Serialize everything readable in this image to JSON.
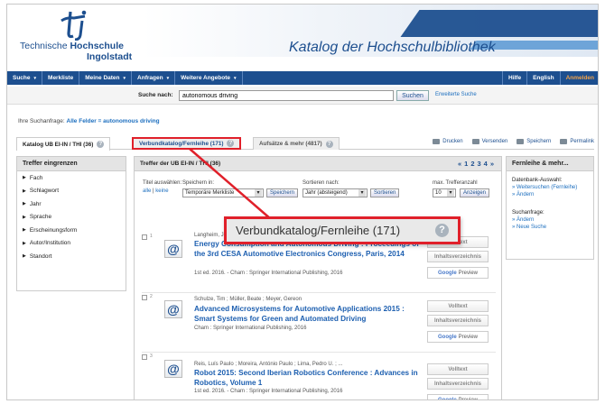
{
  "header": {
    "logo_line1_a": "Technische ",
    "logo_line1_b": "Hochschule",
    "logo_line2": "Ingolstadt",
    "catalog_title": "Katalog der Hochschulbibliothek"
  },
  "nav": {
    "items": [
      {
        "label": "Suche",
        "dd": "▾"
      },
      {
        "label": "Merkliste",
        "dd": ""
      },
      {
        "label": "Meine Daten",
        "dd": "▾"
      },
      {
        "label": "Anfragen",
        "dd": "▾"
      },
      {
        "label": "Weitere Angebote",
        "dd": "▾"
      }
    ],
    "right": [
      "Hilfe",
      "English",
      "Anmelden"
    ]
  },
  "search": {
    "label": "Suche nach:",
    "value": "autonomous driving",
    "button": "Suchen",
    "advanced": "Erweiterte Suche"
  },
  "query": {
    "prefix": "Ihre Suchanfrage:",
    "value": "Alle Felder = autonomous driving"
  },
  "tabs": [
    {
      "label": "Katalog UB EI-IN / THI (36)"
    },
    {
      "label": "Verbundkatalog/Fernleihe (171)"
    },
    {
      "label": "Aufsätze & mehr (4817)"
    }
  ],
  "tools": [
    "Drucken",
    "Versenden",
    "Speichern",
    "Permalink"
  ],
  "facets": {
    "heading": "Treffer eingrenzen",
    "items": [
      "Fach",
      "Schlagwort",
      "Jahr",
      "Sprache",
      "Erscheinungsform",
      "Autor/Institution",
      "Standort"
    ]
  },
  "results": {
    "heading": "Treffer der UB EI-IN / THI (36)",
    "pager": [
      "«",
      "1",
      "2",
      "3",
      "4",
      "»"
    ],
    "controls": {
      "select_label": "Titel auswählen:",
      "select_all": "alle",
      "select_none": "keine",
      "save_label": "Speichern in:",
      "save_value": "Temporäre Merkliste",
      "save_btn": "Speichern",
      "sort_label": "Sortieren nach:",
      "sort_value": "Jahr (absteigend)",
      "sort_btn": "Sortieren",
      "max_label": "max. Trefferanzahl",
      "max_value": "10",
      "show_btn": "Anzeigen"
    },
    "items": [
      {
        "num": "1",
        "authors": "Langheim, Jochen",
        "title": "Energy Consumption and Autonomous Driving : Proceedings of the 3rd CESA Automotive Electronics Congress, Paris, 2014",
        "meta": "1st ed. 2016. - Cham : Springer International Publishing, 2016"
      },
      {
        "num": "2",
        "authors": "Schulze, Tim ; Müller, Beate ; Meyer, Gereon",
        "title": "Advanced Microsystems for Automotive Applications 2015 : Smart Systems for Green and Automated Driving",
        "meta": "Cham : Springer International Publishing, 2016"
      },
      {
        "num": "3",
        "authors": "Reis, Luís Paulo ; Moreira, António Paulo ; Lima, Pedro U. ; ...",
        "title": "Robot 2015: Second Iberian Robotics Conference : Advances in Robotics, Volume 1",
        "meta": "1st ed. 2016. - Cham : Springer International Publishing, 2016"
      }
    ],
    "btn_volltext": "Volltext",
    "btn_inhalt": "Inhaltsverzeichnis",
    "btn_google_g": "Google",
    "btn_google": "Preview"
  },
  "right_sidebar": {
    "heading": "Fernleihe & mehr...",
    "db_label": "Datenbank-Auswahl:",
    "db_links": [
      "» Weitersuchen (Fernleihe)",
      "» Ändern"
    ],
    "q_label": "Suchanfrage:",
    "q_links": [
      "» Ändern",
      "» Neue Suche"
    ]
  },
  "callout": {
    "text": "Verbundkatalog/Fernleihe (171)",
    "icon": "?"
  }
}
